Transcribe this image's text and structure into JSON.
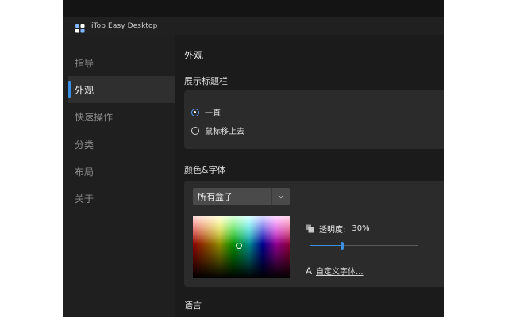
{
  "window": {
    "title": "iTop Easy Desktop",
    "logo_icon": "app-logo-icon"
  },
  "sidebar": {
    "items": [
      {
        "label": "指导",
        "active": false
      },
      {
        "label": "外观",
        "active": true
      },
      {
        "label": "快速操作",
        "active": false
      },
      {
        "label": "分类",
        "active": false
      },
      {
        "label": "布局",
        "active": false
      },
      {
        "label": "关于",
        "active": false
      }
    ]
  },
  "main": {
    "title": "外观",
    "titlebar_section": {
      "label": "展示标题栏",
      "options": [
        {
          "label": "一直",
          "checked": true
        },
        {
          "label": "鼠标移上去",
          "checked": false
        }
      ]
    },
    "color_font_section": {
      "label": "颜色&字体",
      "dropdown_value": "所有盒子",
      "opacity_label": "透明度:",
      "opacity_value": "30%",
      "opacity_fraction": 0.3,
      "custom_font_label": "自定义字体..."
    },
    "language_section": {
      "label": "语言"
    }
  },
  "colors": {
    "accent": "#3a8fe3",
    "background": "#1b1b1b",
    "card": "#2b2b2b"
  }
}
